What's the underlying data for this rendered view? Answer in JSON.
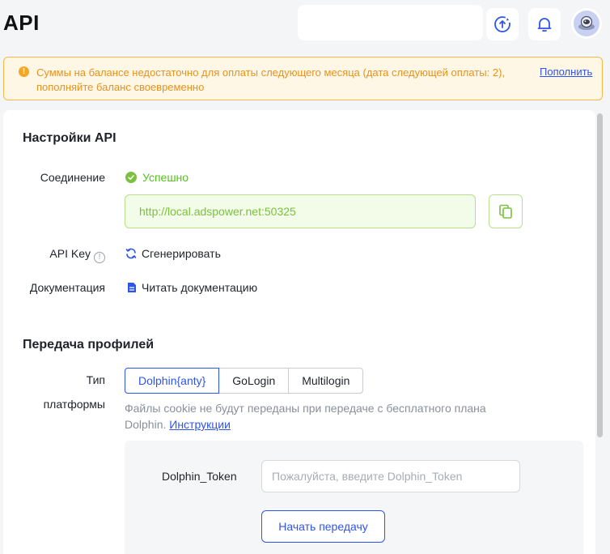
{
  "page": {
    "title": "API"
  },
  "header": {
    "search": {
      "placeholder": ""
    },
    "icons": [
      "upload-sync-icon",
      "bell-icon",
      "avatar"
    ]
  },
  "alert": {
    "text": "Суммы на балансе недостаточно для оплаты следующего месяца (дата следующей оплаты: 2), пополняйте баланс своевременно",
    "link": "Пополнить",
    "color": "#e8921c"
  },
  "api_settings": {
    "title": "Настройки API",
    "connection_label": "Соединение",
    "status": "Успешно",
    "url": "http://local.adspower.net:50325",
    "api_key_label": "API Key",
    "generate_label": "Сгенерировать",
    "docs_label": "Документация",
    "docs_link": "Читать документацию"
  },
  "transfer": {
    "title": "Передача профилей",
    "platform_label_line1": "Тип",
    "platform_label_line2": "платформы",
    "tabs": [
      {
        "label": "Dolphin{anty}",
        "active": true
      },
      {
        "label": "GoLogin",
        "active": false
      },
      {
        "label": "Multilogin",
        "active": false
      }
    ],
    "hint_text": "Файлы cookie не будут переданы при передаче с бесплатного плана Dolphin. ",
    "hint_link": "Инструкции",
    "token_label": "Dolphin_Token",
    "token_value": "",
    "token_placeholder": "Пожалуйста, введите Dolphin_Token",
    "start_button": "Начать передачу"
  },
  "colors": {
    "accent": "#2f54eb",
    "success": "#7cc03f",
    "warning": "#f5a623"
  }
}
